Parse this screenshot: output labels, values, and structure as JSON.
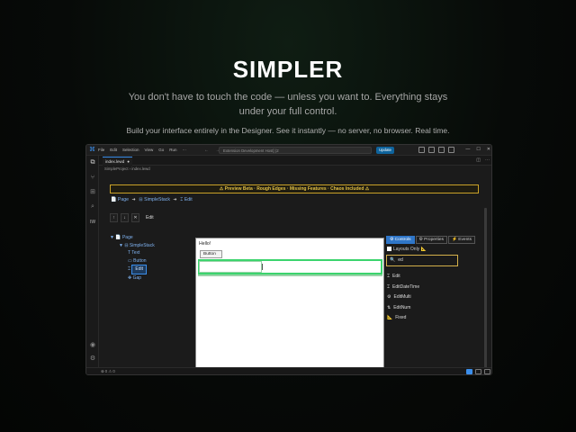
{
  "hero": {
    "title": "SIMPLER",
    "subtitle": "You don't have to touch the code — unless you want to. Everything stays under your full control.",
    "tagline": "Build your interface entirely in the Designer. See it instantly — no server, no browser. Real time."
  },
  "window": {
    "menu": [
      "File",
      "Edit",
      "Selection",
      "View",
      "Go",
      "Run",
      "···"
    ],
    "nav": "← →",
    "search_placeholder": "Extension Development Host] (2",
    "update_label": "Update",
    "controls": [
      "—",
      "☐",
      "✕"
    ]
  },
  "tab": {
    "label": "index.lewd",
    "modified": "●"
  },
  "breadcrumb": "SimpleProject  ›  index.lewd",
  "banner": "⚠ Preview Beta · Rough Edges · Missing Features · Chaos Included ⚠",
  "page_breadcrumb": {
    "page": "Page",
    "stack": "SimpleStack",
    "edit": "Edit",
    "arrow": "➜"
  },
  "toolbar": {
    "up": "↑",
    "down": "↓",
    "delete": "✕",
    "label": "Edit"
  },
  "tree": [
    {
      "label": "▼ 📄 Page",
      "indent": 0
    },
    {
      "label": "▼ ⊟ SimpleStack",
      "indent": 1
    },
    {
      "label": "T Text",
      "indent": 2
    },
    {
      "label": "▭ Button",
      "indent": 2
    },
    {
      "label": "Edit",
      "indent": 2,
      "prefix": "⌶",
      "selected": true
    },
    {
      "label": "✥ Gap",
      "indent": 2
    }
  ],
  "canvas": {
    "hello": "Hello!",
    "button": "Button"
  },
  "panel": {
    "tabs": [
      "⚙ Controls",
      "⚙ Properties",
      "⚡ Events"
    ],
    "layouts_only": "Layouts Only 📐",
    "search_value": "ed",
    "items": [
      {
        "icon": "⌶",
        "label": "Edit"
      },
      {
        "icon": "⌶",
        "label": "EditDateTime"
      },
      {
        "icon": "⚙",
        "label": "EditMulti"
      },
      {
        "icon": "⇅",
        "label": "EditNum"
      },
      {
        "icon": "📐",
        "label": "Fixed"
      }
    ]
  },
  "status": {
    "left": "⊗ 0 ⚠ 0"
  },
  "colors": {
    "accent": "#3b8eea",
    "banner": "#e2c044",
    "selection_green": "#3bd46d",
    "active_tab": "#2f76c8"
  }
}
